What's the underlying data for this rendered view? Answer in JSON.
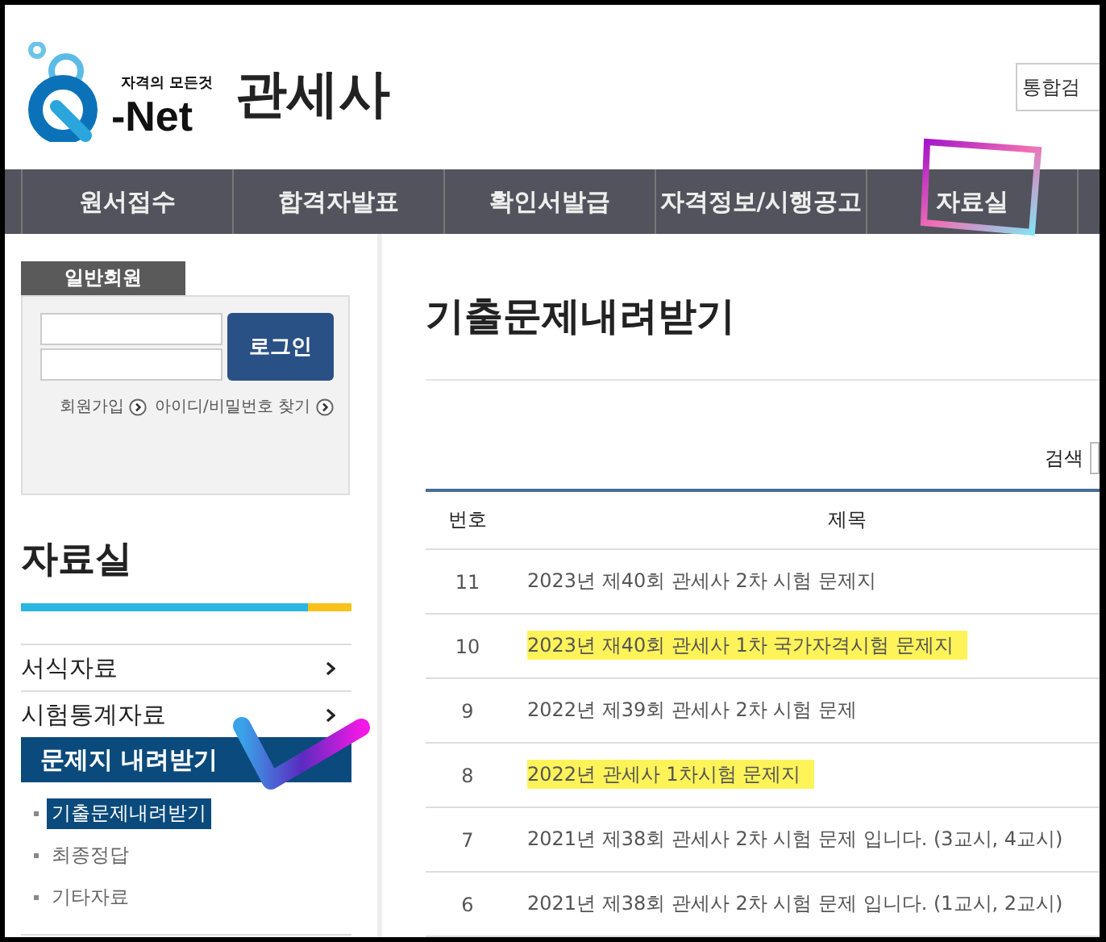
{
  "header": {
    "logo": {
      "tagline": "자격의 모든것",
      "name": "-Net"
    },
    "site_title": "관세사",
    "search": {
      "placeholder": "통합검"
    }
  },
  "nav": {
    "tabs": [
      "원서접수",
      "합격자발표",
      "확인서발급",
      "자격정보/시행공고",
      "자료실"
    ]
  },
  "sidebar": {
    "login": {
      "tab": "일반회원",
      "button": "로그인",
      "links": [
        "회원가입",
        "아이디/비밀번호 찾기"
      ]
    },
    "section_title": "자료실",
    "menu": [
      {
        "label": "서식자료",
        "selected": false
      },
      {
        "label": "시험통계자료",
        "selected": false
      },
      {
        "label": "문제지 내려받기",
        "selected": true,
        "children": [
          {
            "label": "기출문제내려받기",
            "selected": true
          },
          {
            "label": "최종정답",
            "selected": false
          },
          {
            "label": "기타자료",
            "selected": false
          }
        ]
      }
    ]
  },
  "main": {
    "title": "기출문제내려받기",
    "search": {
      "label": "검색"
    },
    "table": {
      "columns": [
        "번호",
        "제목"
      ],
      "rows": [
        {
          "number": "11",
          "title": "2023년 제40회 관세사 2차 시험 문제지",
          "highlighted": false
        },
        {
          "number": "10",
          "title": "2023년 재40회 관세사 1차 국가자격시험 문제지",
          "highlighted": true
        },
        {
          "number": "9",
          "title": "2022년 제39회 관세사 2차 시험 문제",
          "highlighted": false
        },
        {
          "number": "8",
          "title": "2022년 관세사 1차시험 문제지",
          "highlighted": true
        },
        {
          "number": "7",
          "title": "2021년 제38회 관세사 2차 시험 문제 입니다. (3교시, 4교시)",
          "highlighted": false
        },
        {
          "number": "6",
          "title": "2021년 제38회 관세사 2차 시험 문제 입니다. (1교시, 2교시)",
          "highlighted": false
        }
      ]
    }
  },
  "annotations": {
    "box_mark": true,
    "check_mark": true
  }
}
